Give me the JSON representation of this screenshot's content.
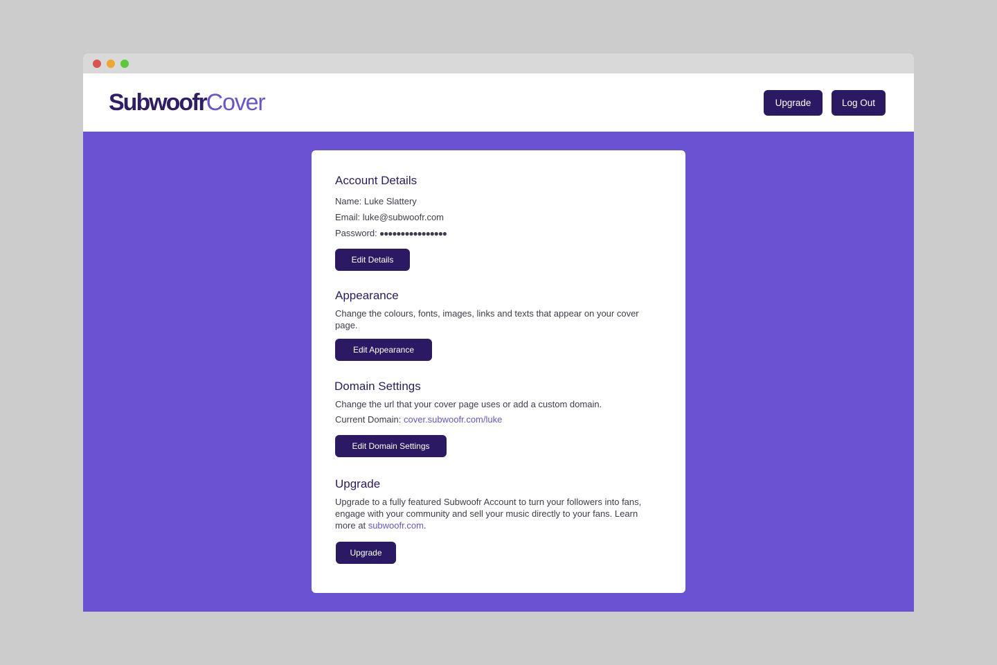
{
  "window": {
    "controls": [
      "close",
      "minimize",
      "maximize"
    ]
  },
  "header": {
    "logo_primary": "Subwoofr",
    "logo_secondary": "Cover",
    "upgrade_label": "Upgrade",
    "logout_label": "Log Out"
  },
  "account": {
    "title": "Account Details",
    "name_label": "Name:",
    "name_value": "Luke Slattery",
    "email_label": "Email:",
    "email_value": "luke@subwoofr.com",
    "password_label": "Password:",
    "password_value": "●●●●●●●●●●●●●●●●",
    "edit_label": "Edit Details"
  },
  "appearance": {
    "title": "Appearance",
    "description": "Change the colours, fonts, images, links and texts that appear on your cover page.",
    "edit_label": "Edit Appearance"
  },
  "domain": {
    "title": "Domain Settings",
    "description": "Change the url that your cover page uses or add a custom domain.",
    "current_label": "Current Domain:",
    "current_value": "cover.subwoofr.com/luke",
    "edit_label": "Edit Domain Settings"
  },
  "upgrade": {
    "title": "Upgrade",
    "description": "Upgrade to a fully featured Subwoofr Account to turn your followers into fans, engage with your community and sell your music directly to your fans.",
    "learn_more": "Learn more at",
    "link_text": "subwoofr.com",
    "link_suffix": ".",
    "button_label": "Upgrade"
  },
  "colors": {
    "brand_dark": "#2b1a63",
    "brand_accent": "#6b52d3",
    "page_background": "#cccccc"
  }
}
